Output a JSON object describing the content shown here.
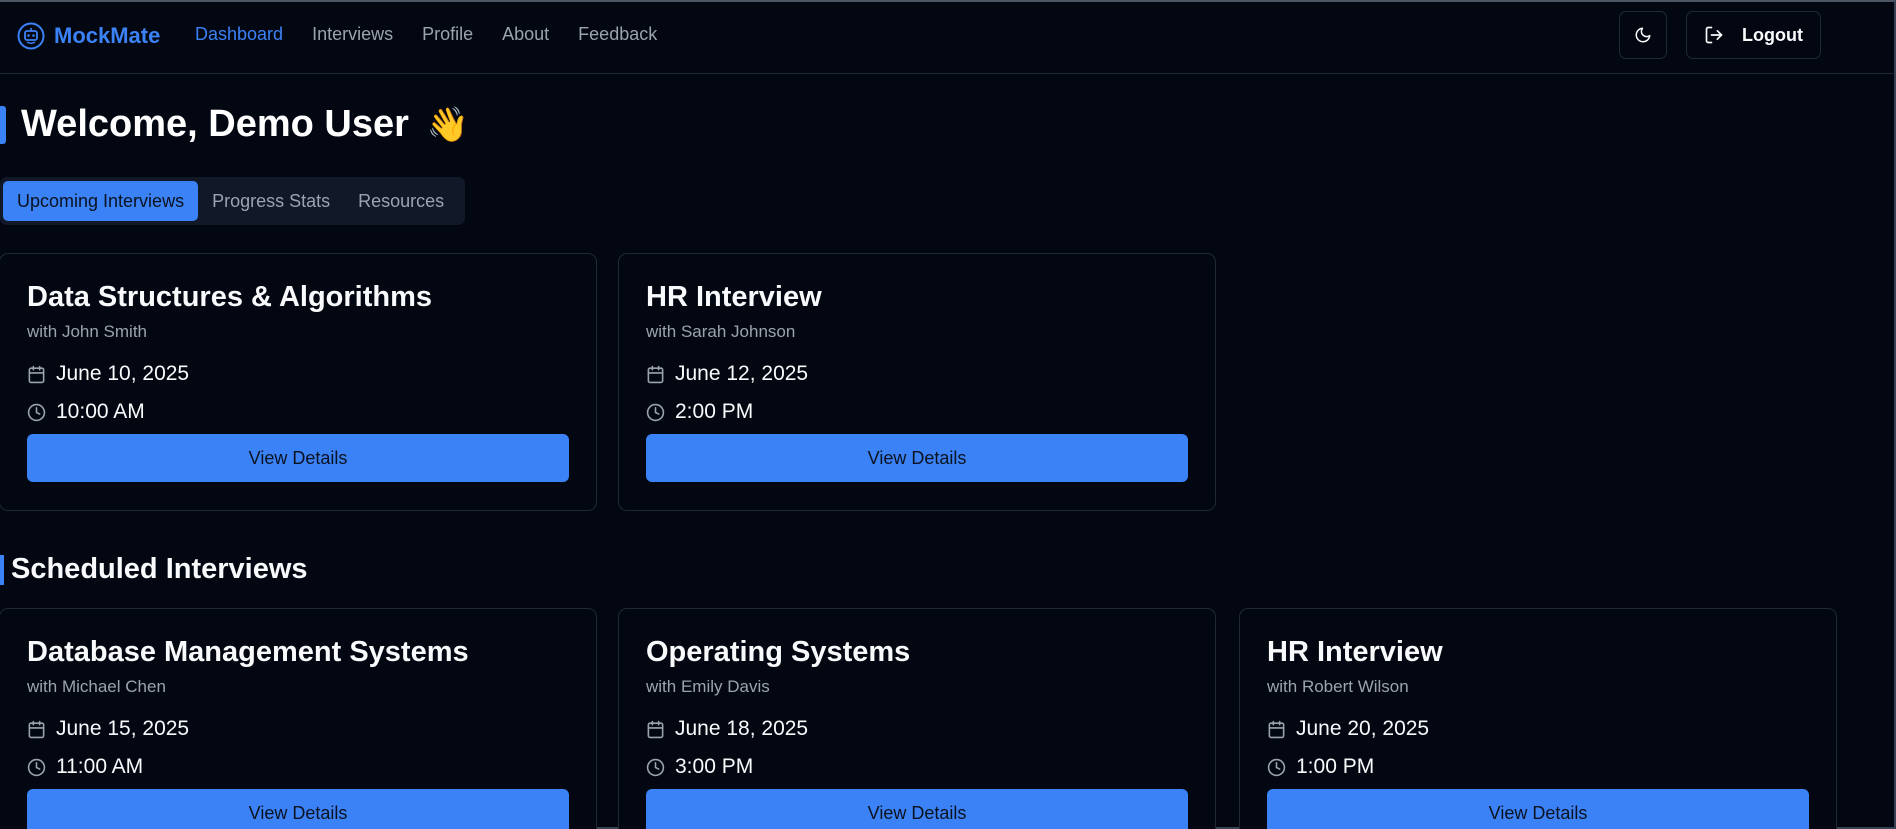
{
  "brand": {
    "name": "MockMate",
    "icon": "robot-face-icon"
  },
  "nav": {
    "links": [
      {
        "label": "Dashboard",
        "active": true
      },
      {
        "label": "Interviews"
      },
      {
        "label": "Profile"
      },
      {
        "label": "About"
      },
      {
        "label": "Feedback"
      }
    ],
    "theme_toggle_icon": "moon-icon",
    "logout_label": "Logout"
  },
  "welcome": {
    "text": "Welcome, Demo User",
    "emoji": "👋"
  },
  "tabs": [
    {
      "label": "Upcoming Interviews",
      "active": true
    },
    {
      "label": "Progress Stats"
    },
    {
      "label": "Resources"
    }
  ],
  "upcoming": [
    {
      "title": "Data Structures & Algorithms",
      "with": "with John Smith",
      "date": "June 10, 2025",
      "time": "10:00 AM",
      "button": "View Details"
    },
    {
      "title": "HR Interview",
      "with": "with Sarah Johnson",
      "date": "June 12, 2025",
      "time": "2:00 PM",
      "button": "View Details"
    }
  ],
  "scheduled_title": "Scheduled Interviews",
  "scheduled": [
    {
      "title": "Database Management Systems",
      "with": "with Michael Chen",
      "date": "June 15, 2025",
      "time": "11:00 AM",
      "button": "View Details"
    },
    {
      "title": "Operating Systems",
      "with": "with Emily Davis",
      "date": "June 18, 2025",
      "time": "3:00 PM",
      "button": "View Details"
    },
    {
      "title": "HR Interview",
      "with": "with Robert Wilson",
      "date": "June 20, 2025",
      "time": "1:00 PM",
      "button": "View Details"
    }
  ],
  "colors": {
    "accent": "#3b82f6",
    "background": "#030712",
    "muted": "#9ca3af",
    "border": "#1f2937"
  }
}
